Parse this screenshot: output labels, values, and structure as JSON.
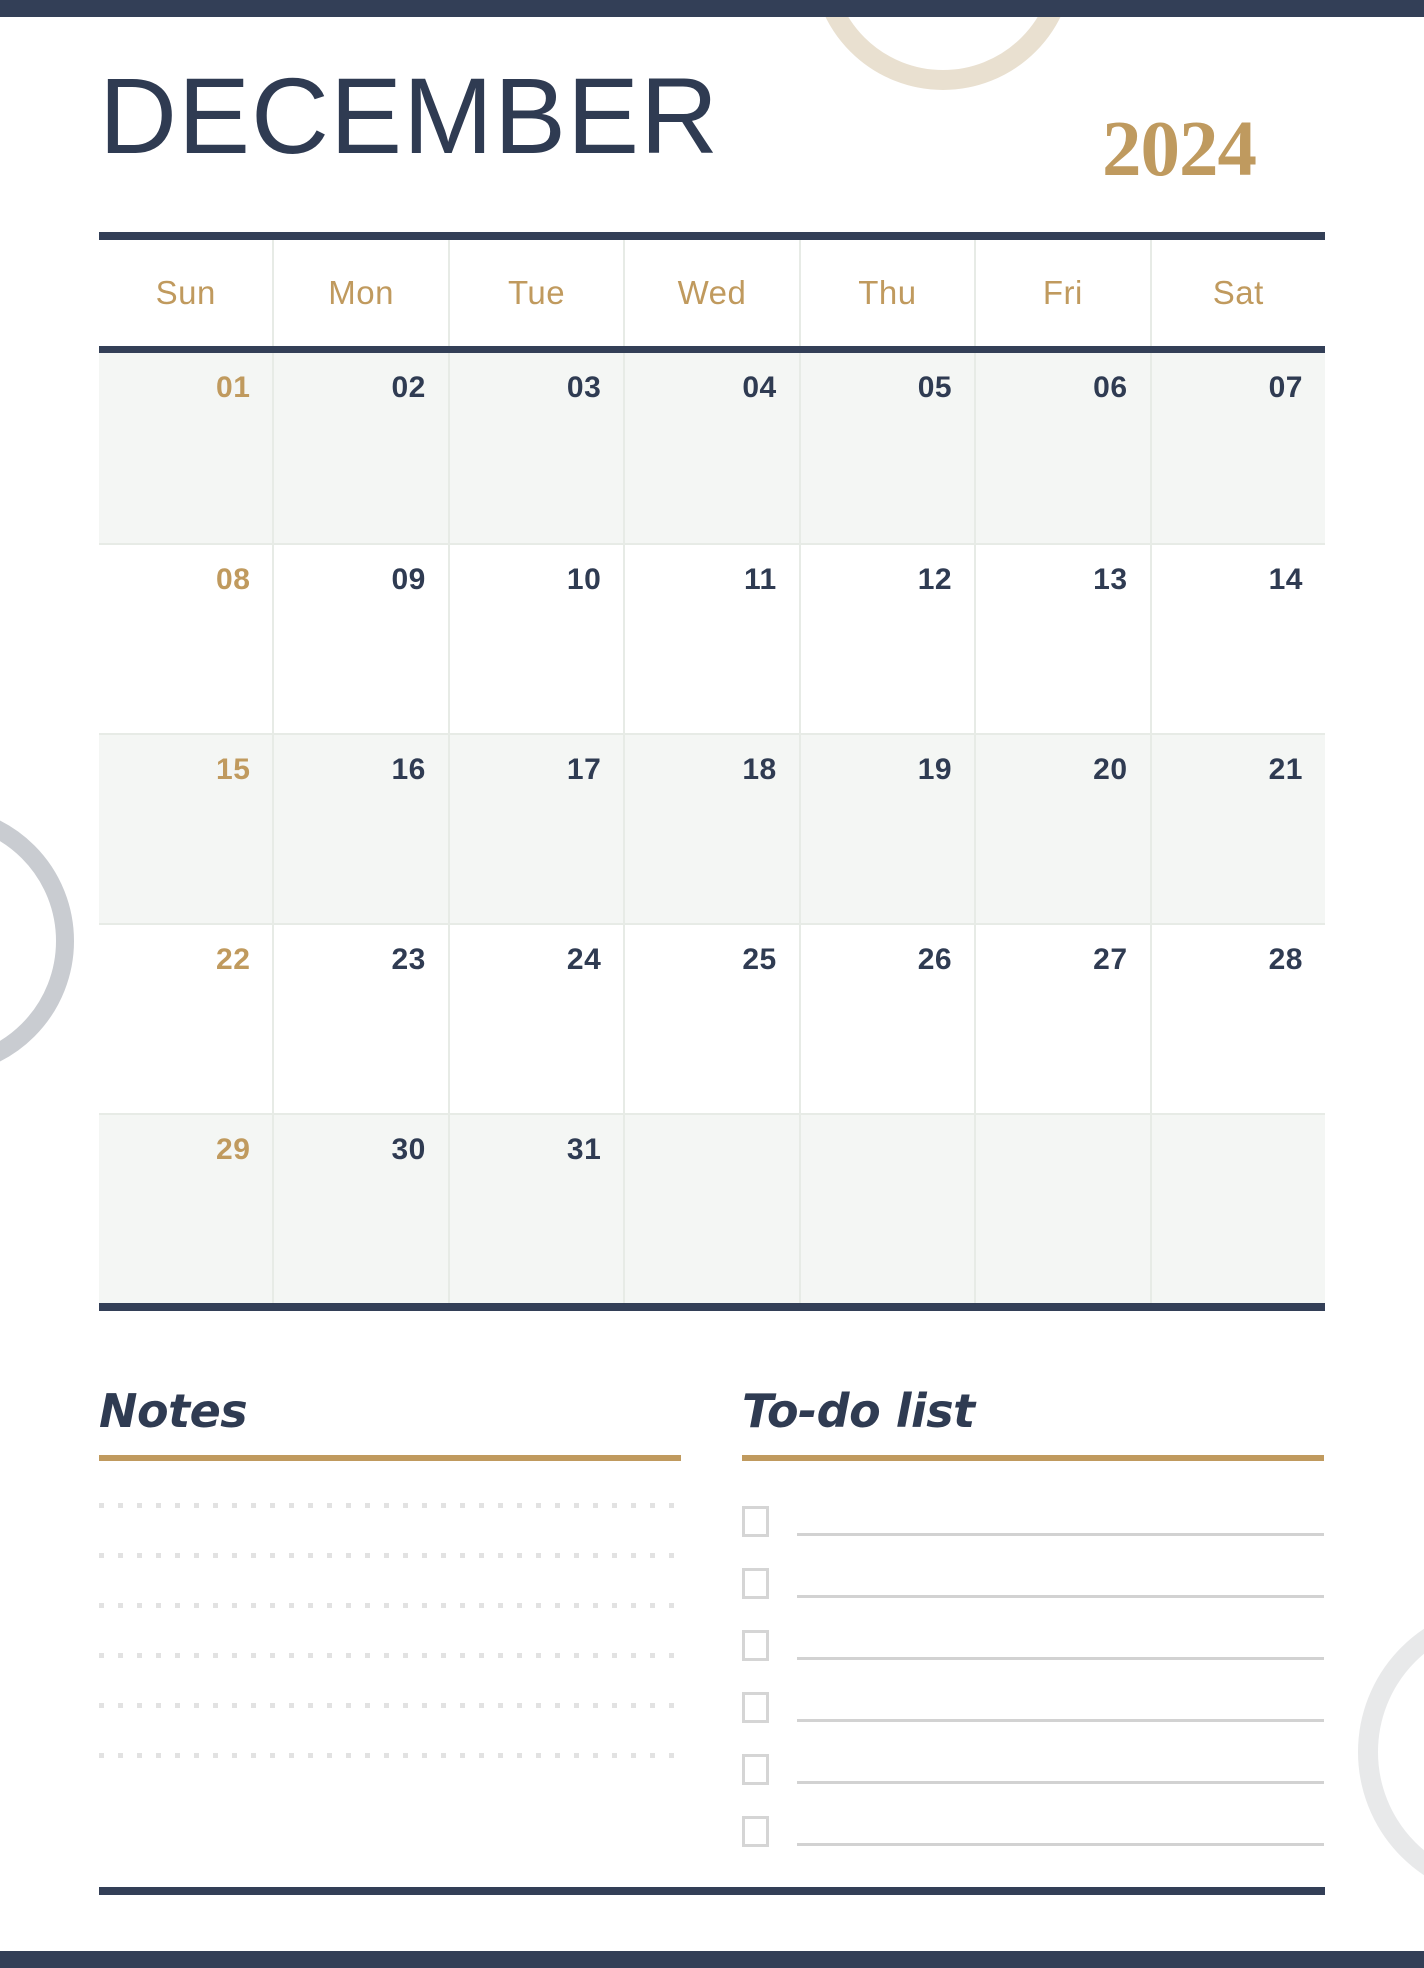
{
  "page": {
    "title": "DECEMBER",
    "year": "2024",
    "colors": {
      "navy": "#333f57",
      "gold": "#c09a5e",
      "row_shade": "#f4f6f4",
      "grid_line": "#e7ebe6",
      "deco_cream": "#e9e0d0",
      "deco_gray": "#c9ccd1",
      "deco_light_gray": "#e8e9ea"
    }
  },
  "calendar": {
    "weekdays": [
      "Sun",
      "Mon",
      "Tue",
      "Wed",
      "Thu",
      "Fri",
      "Sat"
    ],
    "weeks": [
      {
        "shaded": true,
        "days": [
          "01",
          "02",
          "03",
          "04",
          "05",
          "06",
          "07"
        ]
      },
      {
        "shaded": false,
        "days": [
          "08",
          "09",
          "10",
          "11",
          "12",
          "13",
          "14"
        ]
      },
      {
        "shaded": true,
        "days": [
          "15",
          "16",
          "17",
          "18",
          "19",
          "20",
          "21"
        ]
      },
      {
        "shaded": false,
        "days": [
          "22",
          "23",
          "24",
          "25",
          "26",
          "27",
          "28"
        ]
      },
      {
        "shaded": true,
        "days": [
          "29",
          "30",
          "31",
          "",
          "",
          "",
          ""
        ]
      }
    ]
  },
  "notes": {
    "title": "Notes",
    "line_count": 6
  },
  "todo": {
    "title": "To-do list",
    "item_count": 6
  }
}
